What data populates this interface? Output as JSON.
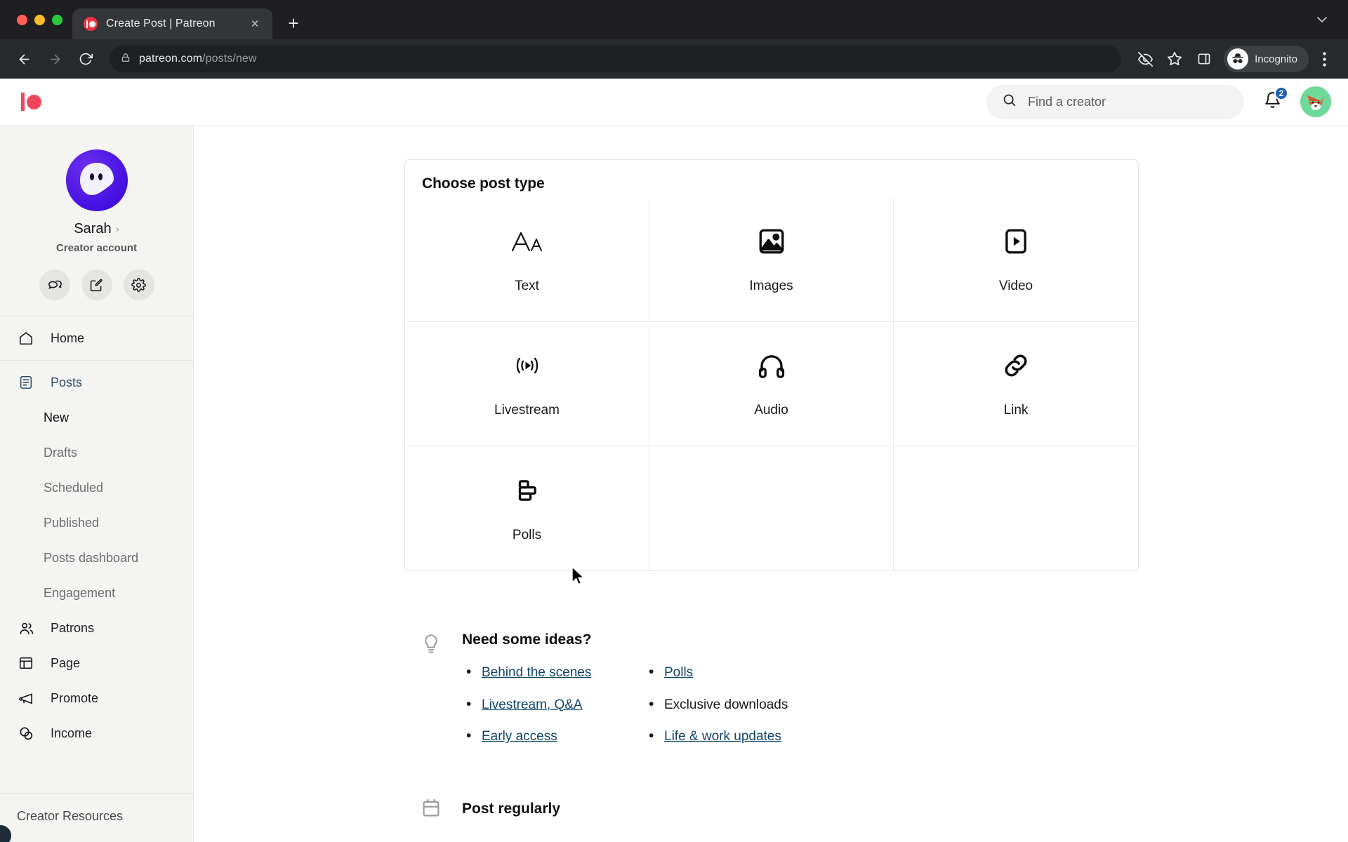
{
  "browser": {
    "tab": {
      "title": "Create Post | Patreon",
      "favicon": "patreon-favicon",
      "close": "×"
    },
    "new_tab_label": "+",
    "tab_list_chevron": "⌄",
    "nav": {
      "back": "back-arrow-icon",
      "forward": "forward-arrow-icon",
      "reload": "reload-icon"
    },
    "omnibox": {
      "lock": "lock-icon",
      "domain": "patreon.com",
      "path": "/posts/new"
    },
    "actions": {
      "tracking_protection": "eye-slash-icon",
      "bookmark": "star-icon",
      "side_panel": "side-panel-icon",
      "profile_label": "Incognito",
      "menu": "three-dot-menu-icon"
    }
  },
  "site_header": {
    "logo": "patreon-logo",
    "search": {
      "placeholder": "Find a creator",
      "icon": "search-icon"
    },
    "notifications": {
      "icon": "bell-icon",
      "count": "2",
      "badge_color": "#1d62b8"
    },
    "avatar": {
      "icon": "fox-avatar",
      "bg_color": "#6fd99a"
    }
  },
  "sidebar": {
    "profile": {
      "name": "Sarah",
      "chevron": "›",
      "role": "Creator account",
      "avatar": "ghost-avatar",
      "avatar_color": "#4310e0",
      "buttons": [
        {
          "name": "messages-button",
          "icon": "chat-bubbles-icon"
        },
        {
          "name": "create-post-button",
          "icon": "edit-pencil-icon"
        },
        {
          "name": "settings-button",
          "icon": "gear-icon"
        }
      ]
    },
    "nav": [
      {
        "label": "Home",
        "icon": "home-icon",
        "type": "item",
        "active": false
      },
      {
        "label": "Posts",
        "icon": "posts-icon",
        "type": "item",
        "active": true
      },
      {
        "label": "New",
        "type": "sub",
        "current": true
      },
      {
        "label": "Drafts",
        "type": "sub",
        "current": false
      },
      {
        "label": "Scheduled",
        "type": "sub",
        "current": false
      },
      {
        "label": "Published",
        "type": "sub",
        "current": false
      },
      {
        "label": "Posts dashboard",
        "type": "sub",
        "current": false
      },
      {
        "label": "Engagement",
        "type": "sub",
        "current": false
      },
      {
        "label": "Patrons",
        "icon": "patrons-icon",
        "type": "item",
        "active": false
      },
      {
        "label": "Page",
        "icon": "page-icon",
        "type": "item",
        "active": false
      },
      {
        "label": "Promote",
        "icon": "megaphone-icon",
        "type": "item",
        "active": false
      },
      {
        "label": "Income",
        "icon": "income-icon",
        "type": "item",
        "active": false
      }
    ],
    "footer": {
      "label": "Creator Resources"
    }
  },
  "main": {
    "post_type_card": {
      "title": "Choose post type",
      "options": [
        {
          "label": "Text",
          "icon": "text-aa-icon"
        },
        {
          "label": "Images",
          "icon": "image-icon"
        },
        {
          "label": "Video",
          "icon": "video-play-icon"
        },
        {
          "label": "Livestream",
          "icon": "livestream-broadcast-icon"
        },
        {
          "label": "Audio",
          "icon": "headphones-icon"
        },
        {
          "label": "Link",
          "icon": "chain-link-icon"
        },
        {
          "label": "Polls",
          "icon": "poll-bars-icon"
        }
      ]
    },
    "ideas": {
      "icon": "lightbulb-icon",
      "title": "Need some ideas?",
      "columns": [
        [
          {
            "label": "Behind the scenes",
            "link": true
          },
          {
            "label": "Livestream, Q&A",
            "link": true
          },
          {
            "label": "Early access",
            "link": true
          }
        ],
        [
          {
            "label": "Polls",
            "link": true
          },
          {
            "label": "Exclusive downloads",
            "link": false
          },
          {
            "label": "Life & work updates",
            "link": true
          }
        ]
      ]
    },
    "post_regularly": {
      "icon": "calendar-icon",
      "title": "Post regularly"
    }
  }
}
